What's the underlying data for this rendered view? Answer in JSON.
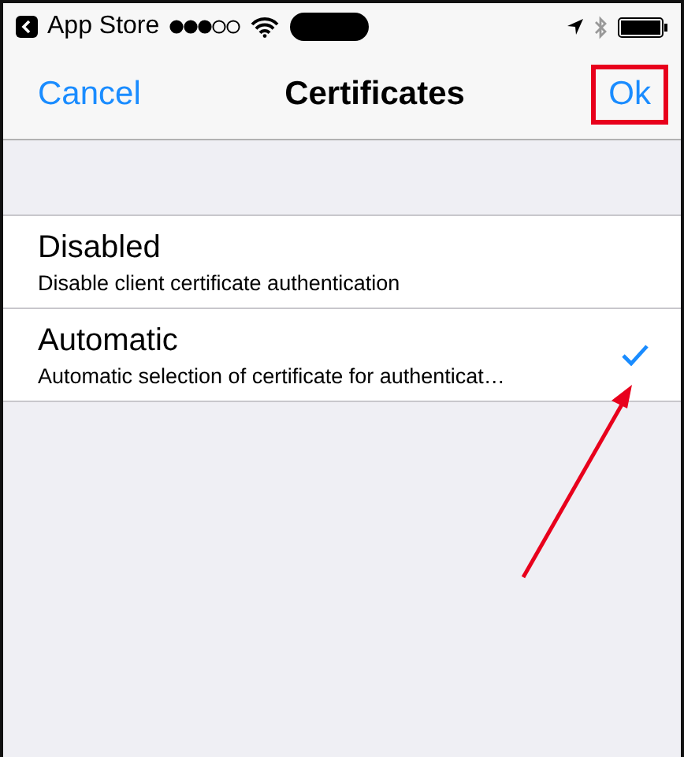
{
  "status_bar": {
    "back_label": "App Store"
  },
  "nav_bar": {
    "cancel": "Cancel",
    "title": "Certificates",
    "ok": "Ok",
    "ok_highlighted": true
  },
  "options": [
    {
      "title": "Disabled",
      "subtitle": "Disable client certificate authentication",
      "selected": false
    },
    {
      "title": "Automatic",
      "subtitle": "Automatic selection of certificate for authenticat…",
      "selected": true
    }
  ],
  "annotation": {
    "arrow_to_selected": true
  }
}
